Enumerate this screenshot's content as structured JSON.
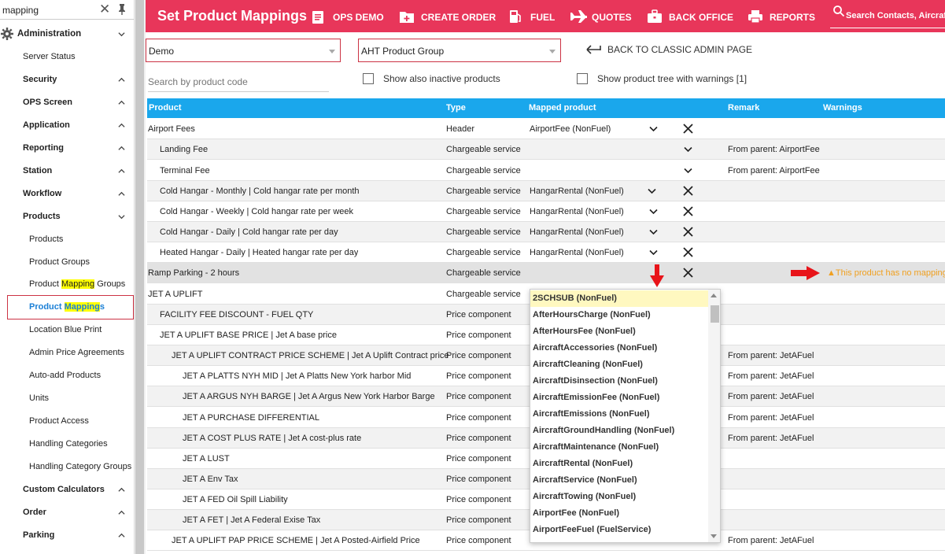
{
  "sidebar": {
    "search_value": "mapping",
    "items": [
      {
        "label": "Administration"
      },
      {
        "label": "Server Status"
      },
      {
        "label": "Security"
      },
      {
        "label": "OPS Screen"
      },
      {
        "label": "Application"
      },
      {
        "label": "Reporting"
      },
      {
        "label": "Station"
      },
      {
        "label": "Workflow"
      },
      {
        "label": "Products"
      },
      {
        "label": "Products"
      },
      {
        "label": "Product Groups"
      },
      {
        "label_pre": "Product ",
        "label_mark": "Mapping",
        "label_post": " Groups"
      },
      {
        "label_pre": "Product ",
        "label_mark": "Mapping",
        "label_post": "s"
      },
      {
        "label": "Location Blue Print"
      },
      {
        "label": "Admin Price Agreements"
      },
      {
        "label": "Auto-add Products"
      },
      {
        "label": "Units"
      },
      {
        "label": "Product Access"
      },
      {
        "label": "Handling Categories"
      },
      {
        "label": "Handling Category Groups"
      },
      {
        "label": "Custom Calculators"
      },
      {
        "label": "Order"
      },
      {
        "label": "Parking"
      }
    ]
  },
  "topbar": {
    "title": "Set Product Mappings",
    "buttons": [
      "OPS DEMO",
      "CREATE ORDER",
      "FUEL",
      "QUOTES",
      "BACK OFFICE",
      "REPORTS"
    ],
    "search_placeholder": "Search Contacts, Aircraft,"
  },
  "filters": {
    "company": "Demo",
    "product_group": "AHT Product Group",
    "back_link": "BACK TO CLASSIC ADMIN PAGE",
    "search_placeholder": "Search by product code",
    "show_inactive": "Show also inactive products",
    "show_tree_warnings": "Show product tree with warnings [1]"
  },
  "table": {
    "headers": [
      "Product",
      "Type",
      "Mapped product",
      "Remark",
      "Warnings"
    ],
    "rows": [
      {
        "product": "Airport Fees",
        "type": "Header",
        "mapped": "AirportFee (NonFuel)",
        "remark": "",
        "warning": ""
      },
      {
        "product": "Landing Fee",
        "type": "Chargeable service",
        "mapped": "",
        "remark": "From parent: AirportFee",
        "warning": ""
      },
      {
        "product": "Terminal Fee",
        "type": "Chargeable service",
        "mapped": "",
        "remark": "From parent: AirportFee",
        "warning": ""
      },
      {
        "product": "Cold Hangar - Monthly | Cold hangar rate per month",
        "type": "Chargeable service",
        "mapped": "HangarRental (NonFuel)",
        "remark": "",
        "warning": ""
      },
      {
        "product": "Cold Hangar - Weekly | Cold hangar rate per week",
        "type": "Chargeable service",
        "mapped": "HangarRental (NonFuel)",
        "remark": "",
        "warning": ""
      },
      {
        "product": "Cold Hangar - Daily | Cold hangar rate per day",
        "type": "Chargeable service",
        "mapped": "HangarRental (NonFuel)",
        "remark": "",
        "warning": ""
      },
      {
        "product": "Heated Hangar - Daily | Heated hangar rate per day",
        "type": "Chargeable service",
        "mapped": "HangarRental (NonFuel)",
        "remark": "",
        "warning": ""
      },
      {
        "product": "Ramp Parking - 2 hours",
        "type": "Chargeable service",
        "mapped": "",
        "remark": "",
        "warning": "▲This product has no mapping"
      },
      {
        "product": "JET A UPLIFT",
        "type": "Chargeable service",
        "mapped": "",
        "remark": "",
        "warning": ""
      },
      {
        "product": "FACILITY FEE DISCOUNT - FUEL QTY",
        "type": "Price component",
        "mapped": "",
        "remark": "",
        "warning": ""
      },
      {
        "product": "JET A UPLIFT BASE PRICE | Jet A base price",
        "type": "Price component",
        "mapped": "",
        "remark": "",
        "warning": ""
      },
      {
        "product": "JET A UPLIFT CONTRACT PRICE SCHEME | Jet A Uplift Contract price",
        "type": "Price component",
        "mapped": "",
        "remark": "From parent: JetAFuel",
        "warning": ""
      },
      {
        "product": "JET A PLATTS NYH MID | Jet A Platts New York harbor Mid",
        "type": "Price component",
        "mapped": "",
        "remark": "From parent: JetAFuel",
        "warning": ""
      },
      {
        "product": "JET A ARGUS NYH BARGE | Jet A Argus New York Harbor Barge",
        "type": "Price component",
        "mapped": "",
        "remark": "From parent: JetAFuel",
        "warning": ""
      },
      {
        "product": "JET A PURCHASE DIFFERENTIAL",
        "type": "Price component",
        "mapped": "",
        "remark": "From parent: JetAFuel",
        "warning": ""
      },
      {
        "product": "JET A COST PLUS RATE | Jet A cost-plus rate",
        "type": "Price component",
        "mapped": "",
        "remark": "From parent: JetAFuel",
        "warning": ""
      },
      {
        "product": "JET A LUST",
        "type": "Price component",
        "mapped": "",
        "remark": "",
        "warning": ""
      },
      {
        "product": "JET A Env Tax",
        "type": "Price component",
        "mapped": "",
        "remark": "",
        "warning": ""
      },
      {
        "product": "JET A FED Oil Spill Liability",
        "type": "Price component",
        "mapped": "",
        "remark": "",
        "warning": ""
      },
      {
        "product": "JET A FET | Jet A Federal Exise Tax",
        "type": "Price component",
        "mapped": "",
        "remark": "",
        "warning": ""
      },
      {
        "product": "JET A UPLIFT PAP PRICE SCHEME | Jet A Posted-Airfield Price",
        "type": "Price component",
        "mapped": "",
        "remark": "From parent: JetAFuel",
        "warning": ""
      }
    ]
  },
  "dropdown": {
    "options": [
      "2SCHSUB (NonFuel)",
      "AfterHoursCharge (NonFuel)",
      "AfterHoursFee (NonFuel)",
      "AircraftAccessories (NonFuel)",
      "AircraftCleaning (NonFuel)",
      "AircraftDisinsection (NonFuel)",
      "AircraftEmissionFee (NonFuel)",
      "AircraftEmissions (NonFuel)",
      "AircraftGroundHandling (NonFuel)",
      "AircraftMaintenance (NonFuel)",
      "AircraftRental (NonFuel)",
      "AircraftService (NonFuel)",
      "AircraftTowing (NonFuel)",
      "AirportFee (NonFuel)",
      "AirportFeeFuel (FuelService)"
    ]
  },
  "colors": {
    "topbar": "#e8365a",
    "table_header": "#1aa7ec",
    "warning": "#f0a020",
    "selected_link": "#1a7fd6",
    "highlight": "#ffff00"
  }
}
